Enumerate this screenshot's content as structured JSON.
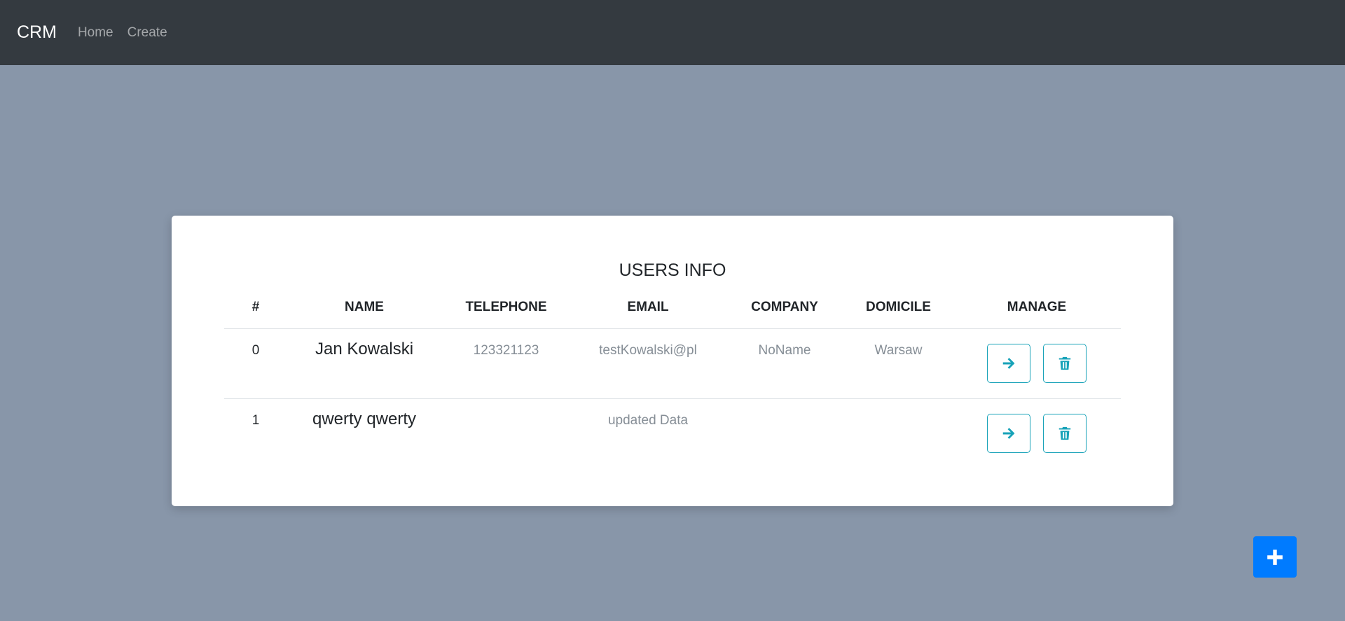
{
  "navbar": {
    "brand": "CRM",
    "links": [
      "Home",
      "Create"
    ]
  },
  "table": {
    "title": "USERS INFO",
    "headers": [
      "#",
      "NAME",
      "TELEPHONE",
      "EMAIL",
      "COMPANY",
      "DOMICILE",
      "MANAGE"
    ],
    "rows": [
      {
        "index": "0",
        "name": "Jan Kowalski",
        "telephone": "123321123",
        "email": "testKowalski@pl",
        "company": "NoName",
        "domicile": "Warsaw"
      },
      {
        "index": "1",
        "name": "qwerty qwerty",
        "telephone": "",
        "email": "updated Data",
        "company": "",
        "domicile": ""
      }
    ]
  },
  "icons": {
    "details": "arrow-right-icon",
    "delete": "trash-icon",
    "add": "plus-icon"
  },
  "colors": {
    "navbar_bg": "#343a40",
    "page_bg": "#8896a9",
    "accent": "#17a2b8",
    "primary": "#007bff"
  }
}
